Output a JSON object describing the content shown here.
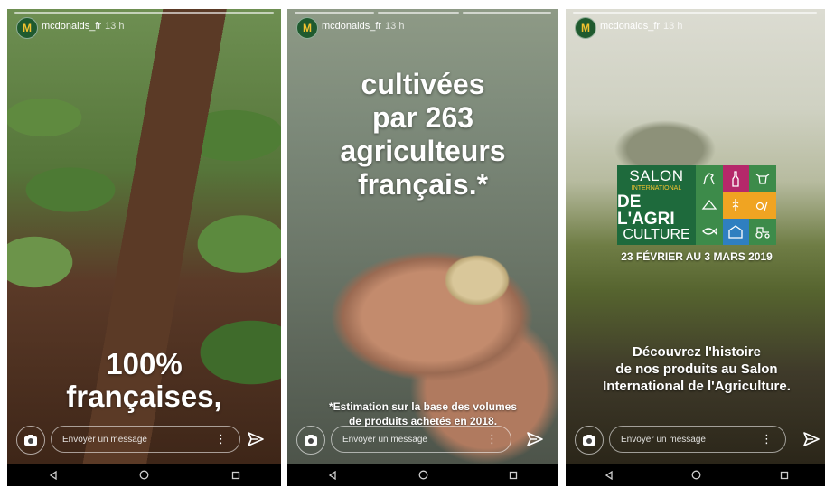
{
  "stories": [
    {
      "username": "mcdonalds_fr",
      "time": "13 h",
      "headline_lines": [
        "100%",
        "françaises,"
      ],
      "reply_placeholder": "Envoyer un message"
    },
    {
      "username": "mcdonalds_fr",
      "time": "13 h",
      "headline_lines": [
        "cultivées",
        "par 263",
        "agriculteurs",
        "français.*"
      ],
      "footnote_lines": [
        "*Estimation sur la base des volumes",
        "de produits achetés en 2018."
      ],
      "reply_placeholder": "Envoyer un message"
    },
    {
      "username": "mcdonalds_fr",
      "time": "13 h",
      "logo": {
        "line1": "SALON",
        "line2": "INTERNATIONAL",
        "line3": "DE L'AGRI",
        "line4": "CULTURE"
      },
      "date": "23 FÉVRIER AU 3 MARS 2019",
      "body_lines": [
        "Découvrez l'histoire",
        "de nos produits au Salon",
        "International de l'Agriculture."
      ],
      "reply_placeholder": "Envoyer un message"
    }
  ],
  "avatar_letter": "M",
  "icons": {
    "camera": "camera-icon",
    "send": "send-icon",
    "more": "more-vertical-icon",
    "nav_back": "nav-back-icon",
    "nav_home": "nav-home-icon",
    "nav_recents": "nav-recents-icon"
  },
  "colors": {
    "mcdonalds_yellow": "#f2c230",
    "salon_green": "#1e6a3c"
  }
}
